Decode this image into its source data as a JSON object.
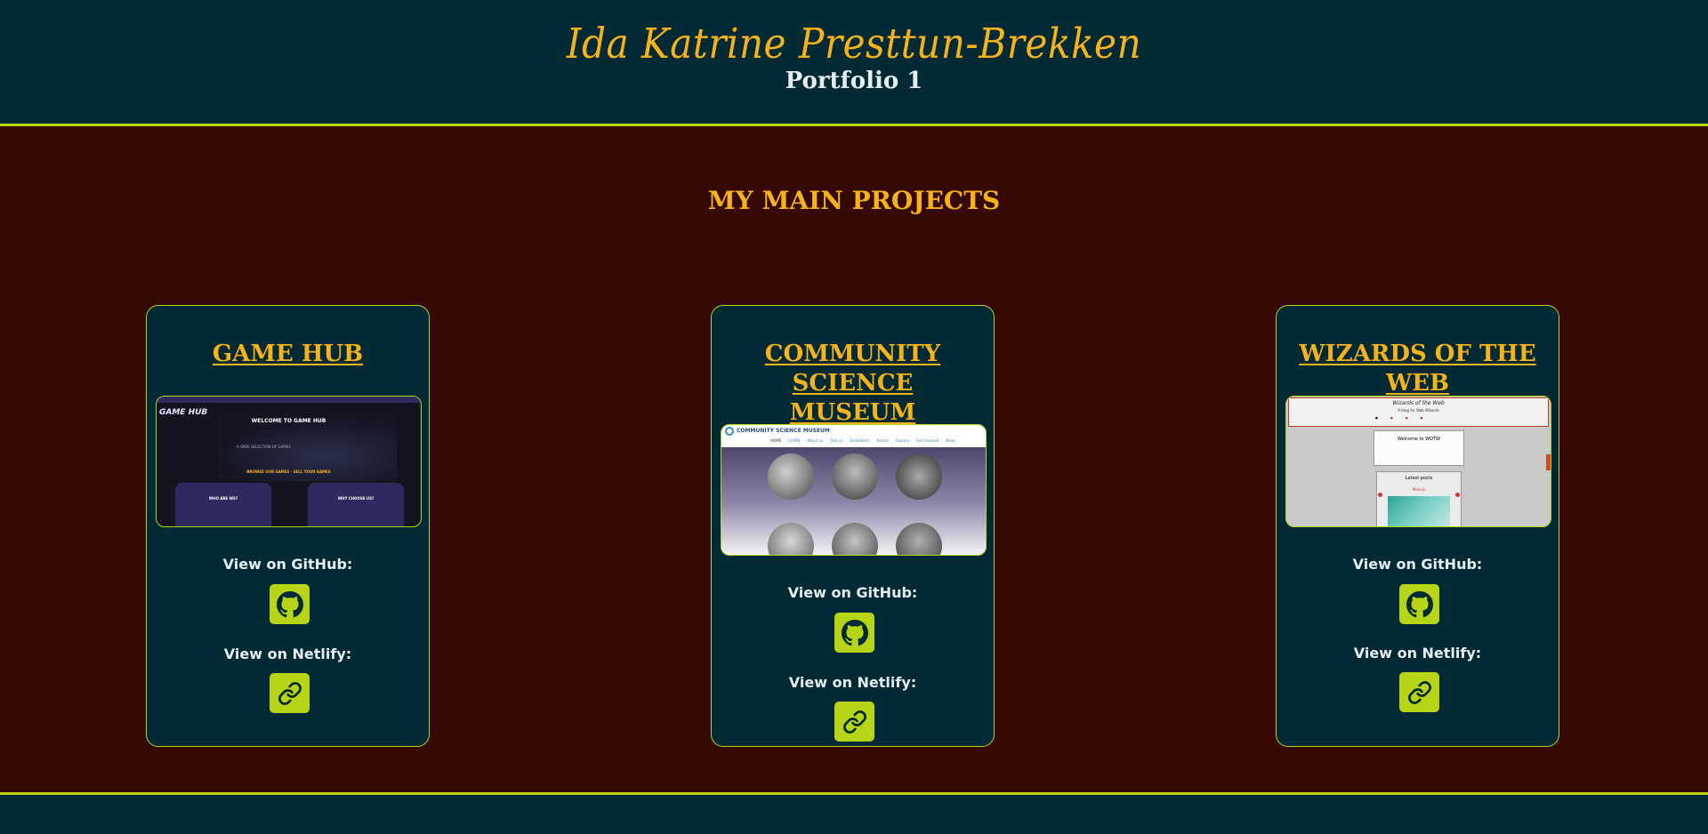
{
  "header": {
    "name": "Ida Katrine Presttun-Brekken",
    "subtitle": "Portfolio 1"
  },
  "main": {
    "section_title": "MY MAIN PROJECTS",
    "view_github_label": "View on GitHub:",
    "view_netlify_label": "View on Netlify:",
    "projects": [
      {
        "title": "GAME HUB",
        "screenshot": {
          "logo": "GAME HUB",
          "heading": "WELCOME TO GAME HUB",
          "tagline": "A WIDE SELECTION OF GAMES",
          "cta": "BROWSE OUR GAMES · SELL YOUR GAMES",
          "box_left": "WHO ARE WE?",
          "box_right": "WHY CHOOSE US?"
        }
      },
      {
        "title": "COMMUNITY SCIENCE MUSEUM",
        "screenshot": {
          "logo": "COMMUNITY SCIENCE MUSEUM",
          "nav": [
            "HOME",
            "LEARN",
            "About us",
            "Visit us",
            "Exhibitions",
            "Events",
            "Explore",
            "Get involved",
            "News"
          ]
        }
      },
      {
        "title": "WIZARDS OF THE WEB",
        "screenshot": {
          "logo": "Wizards of the Web",
          "tagline": "A blog for Web Wizards",
          "heading": "Welcome to WOTW",
          "latest": "Latest posts",
          "post": "Moncia"
        }
      }
    ]
  },
  "colors": {
    "header_bg": "#012a35",
    "body_bg": "#360904",
    "accent": "#b8d416",
    "title_gold": "#f6b21a",
    "text_light": "#e6ecf0"
  },
  "icons": [
    "github-icon",
    "link-icon"
  ]
}
